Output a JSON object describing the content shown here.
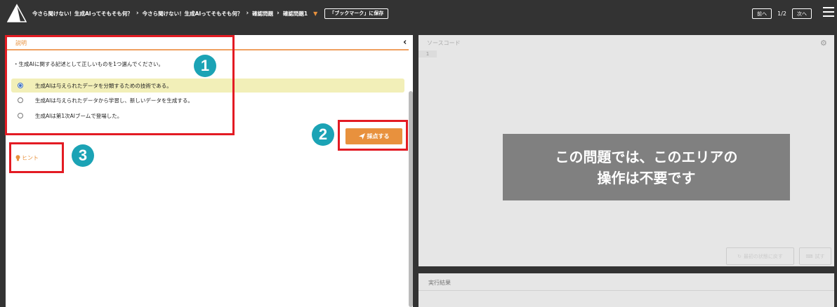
{
  "header": {
    "breadcrumbs": [
      "今さら聞けない！生成AIってそもそも何？",
      "今さら聞けない！生成AIってそもそも何？",
      "確認問題",
      "確認問題1"
    ],
    "bookmark_label": "「ブックマーク」に保存",
    "prev_label": "前へ",
    "page_indicator": "1/2",
    "next_label": "次へ"
  },
  "left": {
    "tab_label": "説明",
    "question": "・生成AIに関する記述として正しいものを1つ選んでください。",
    "options": [
      {
        "label": "生成AIは与えられたデータを分類するための技術である。",
        "selected": true
      },
      {
        "label": "生成AIは与えられたデータから学習し、新しいデータを生成する。",
        "selected": false
      },
      {
        "label": "生成AIは第1次AIブームで登場した。",
        "selected": false
      }
    ],
    "grade_label": "採点する",
    "hint_label": "ヒント"
  },
  "annotations": [
    "1",
    "2",
    "3"
  ],
  "right": {
    "tab_label": "ソースコード",
    "line_number": "1",
    "overlay_line1": "この問題では、このエリアの",
    "overlay_line2": "操作は不要です",
    "reset_label": "最初の状態に戻す",
    "try_label": "試す",
    "result_label": "実行結果"
  },
  "colors": {
    "accent": "#e8913d",
    "annotation": "#e31b23",
    "badge": "#1ba3b5"
  }
}
